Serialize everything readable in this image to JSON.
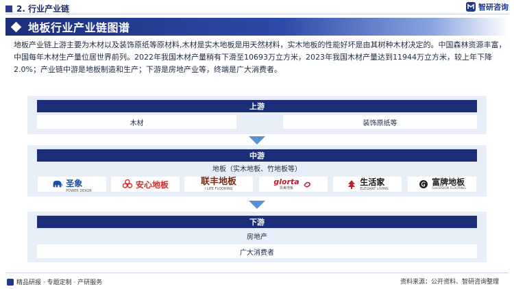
{
  "header": {
    "section": "2. 行业产业链",
    "brand": "智研咨询"
  },
  "title": "地板行业产业链图谱",
  "intro": "地板产业链上游主要为木材以及装饰原纸等原材料,木材是实木地板是用天然材料，实木地板的性能好坏是由其树种木材决定的。中国森林资源丰富，中国每年木材生产量位居世界前列。2022年我国木材产量稍有下滑至10693万立方米，2023年我国木材产量达到11944万立方米，较上年下降2.0%；产业链中游是地板制造和生产；下游是房地产业等，终端是广大消费者。",
  "upstream": {
    "label": "上游",
    "items": [
      "木材",
      "装饰原纸等"
    ]
  },
  "midstream": {
    "label": "中游",
    "subtitle": "地板（实木地板、竹地板等）",
    "logos": [
      {
        "name": "圣象",
        "sub": "POWER DEKOR",
        "color": "#1e4fa0",
        "icon": "elephant-icon"
      },
      {
        "name": "安心地板",
        "sub": "",
        "color": "#d62a2a",
        "icon": "flower-icon"
      },
      {
        "name": "联丰地板",
        "sub": "I LIFE FLOORING",
        "color": "#7a2a14",
        "icon": ""
      },
      {
        "name": "glorta",
        "sub": "凯美地板",
        "color": "#c0182a",
        "icon": "swirl-icon"
      },
      {
        "name": "生活家",
        "sub": "ELEGANT LIVING",
        "color": "#111111",
        "icon": "tree-icon"
      },
      {
        "name": "富牌地板",
        "sub": "GOODSIGN FLOORING",
        "color": "#222222",
        "icon": "g-circle-icon"
      }
    ]
  },
  "downstream": {
    "label": "下游",
    "items": [
      "房地产",
      "广大消费者"
    ]
  },
  "footer": {
    "left": "精品研报 · 专题定制 · 产研服务",
    "right": "资料来源：公开资料、智研咨询整理"
  },
  "colors": {
    "navy": "#1d2e78",
    "panel": "#e7eef7",
    "accent": "#2b4ba8"
  }
}
